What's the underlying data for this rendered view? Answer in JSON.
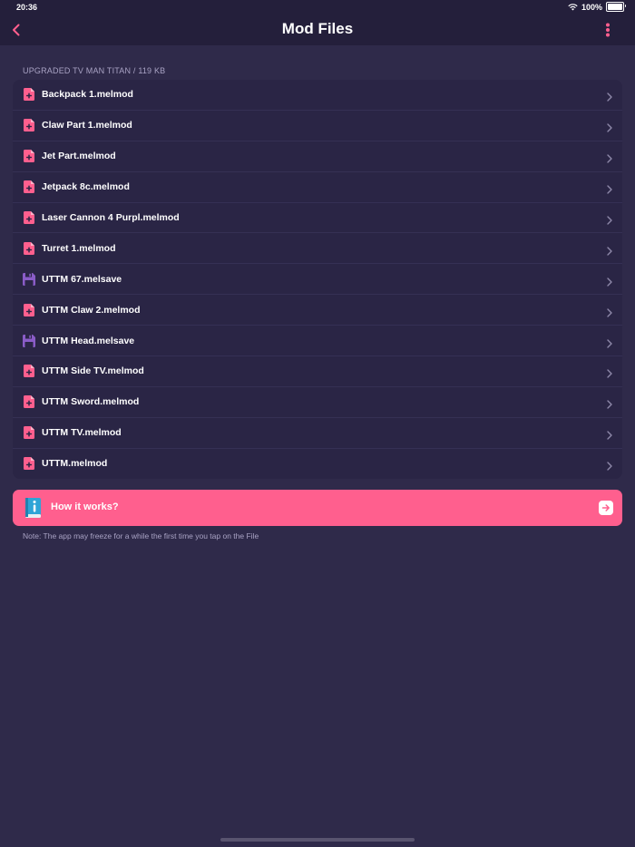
{
  "status_bar": {
    "time": "20:36",
    "battery": "100%"
  },
  "nav": {
    "title": "Mod Files"
  },
  "section": {
    "header": "UPGRADED TV MAN TITAN / 119 KB"
  },
  "files": [
    {
      "name": "Backpack 1.melmod",
      "type": "melmod"
    },
    {
      "name": "Claw Part 1.melmod",
      "type": "melmod"
    },
    {
      "name": "Jet Part.melmod",
      "type": "melmod"
    },
    {
      "name": "Jetpack 8c.melmod",
      "type": "melmod"
    },
    {
      "name": "Laser Cannon 4 Purpl.melmod",
      "type": "melmod"
    },
    {
      "name": "Turret 1.melmod",
      "type": "melmod"
    },
    {
      "name": "UTTM 67.melsave",
      "type": "melsave"
    },
    {
      "name": "UTTM Claw 2.melmod",
      "type": "melmod"
    },
    {
      "name": "UTTM Head.melsave",
      "type": "melsave"
    },
    {
      "name": "UTTM Side TV.melmod",
      "type": "melmod"
    },
    {
      "name": "UTTM Sword.melmod",
      "type": "melmod"
    },
    {
      "name": "UTTM TV.melmod",
      "type": "melmod"
    },
    {
      "name": "UTTM.melmod",
      "type": "melmod"
    }
  ],
  "how_it_works": {
    "label": "How it works?"
  },
  "note": "Note: The app may freeze for a while the first time you tap on the File",
  "colors": {
    "background": "#2f2a4a",
    "bar": "#241f3b",
    "accent": "#ff5f8e",
    "melsave_icon": "#8a5cc7"
  },
  "icons": {
    "back": "chevron-left-icon",
    "more": "more-vertical-icon",
    "melmod": "document-add-icon",
    "melsave": "floppy-disk-icon",
    "row_chevron": "chevron-right-icon",
    "book": "info-book-icon",
    "arrow": "arrow-right-icon"
  }
}
